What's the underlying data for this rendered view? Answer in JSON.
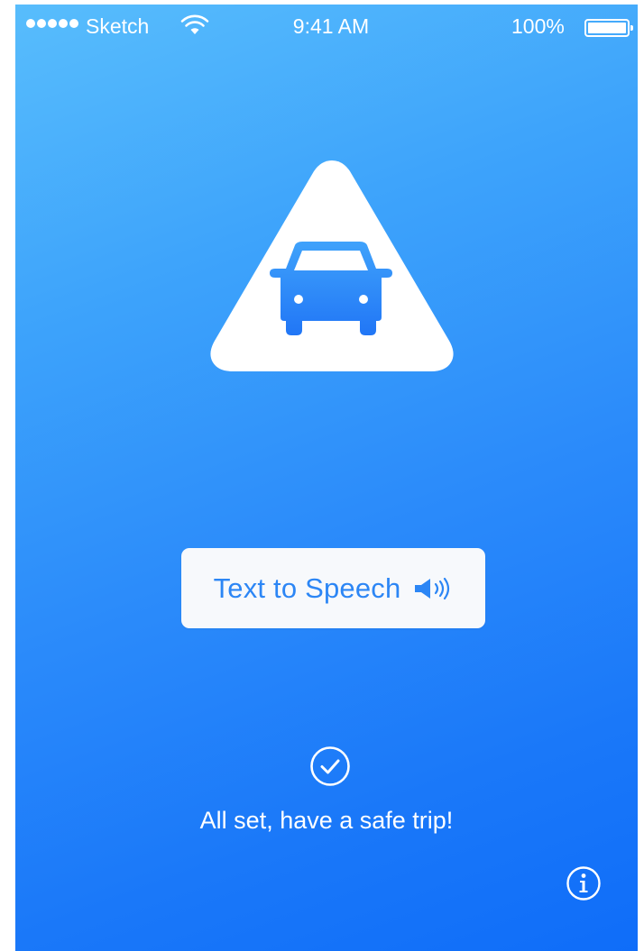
{
  "status_bar": {
    "carrier": "Sketch",
    "time": "9:41 AM",
    "battery": "100%",
    "icons": [
      "signal-dots-icon",
      "wifi-icon",
      "battery-icon"
    ]
  },
  "hero": {
    "icons": [
      "warning-triangle-icon",
      "car-icon"
    ]
  },
  "tts_button": {
    "label": "Text to Speech",
    "icon": "speaker-icon"
  },
  "status": {
    "icon": "checkmark-circle-icon",
    "message": "All set, have a safe trip!"
  },
  "info": {
    "icon": "info-icon"
  },
  "colors": {
    "gradient_top": "#58bdfc",
    "gradient_bottom": "#0f6df9",
    "button_bg": "#f7f9fc",
    "button_text": "#2c86f5",
    "foreground": "#ffffff"
  }
}
